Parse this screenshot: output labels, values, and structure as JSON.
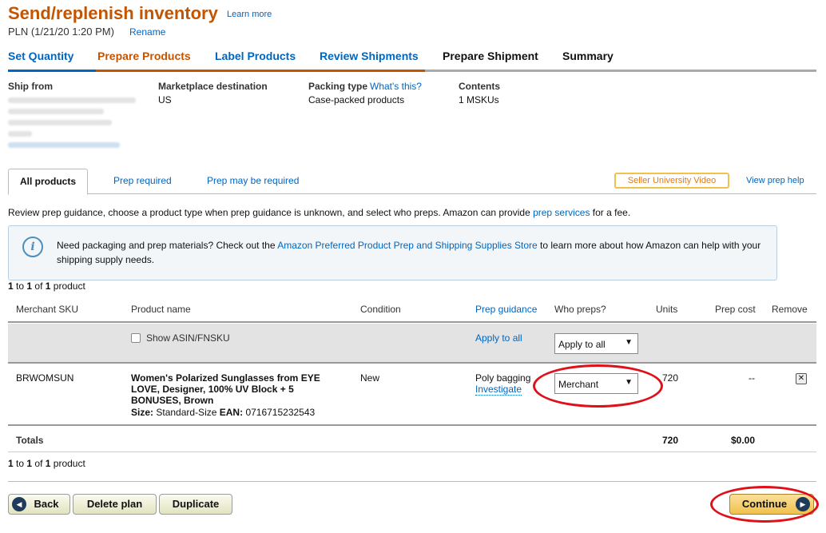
{
  "header": {
    "title": "Send/replenish inventory",
    "learn_more": "Learn more",
    "plan_name": "PLN (1/21/20 1:20 PM)",
    "rename": "Rename"
  },
  "steps": [
    {
      "label": "Set Quantity",
      "state": "done"
    },
    {
      "label": "Prepare Products",
      "state": "active"
    },
    {
      "label": "Label Products",
      "state": "done"
    },
    {
      "label": "Review Shipments",
      "state": "done"
    },
    {
      "label": "Prepare Shipment",
      "state": "future"
    },
    {
      "label": "Summary",
      "state": "future"
    }
  ],
  "info": {
    "ship_from_label": "Ship from",
    "marketplace_label": "Marketplace destination",
    "marketplace_value": "US",
    "packing_label": "Packing type",
    "packing_link": "What's this?",
    "packing_value": "Case-packed products",
    "contents_label": "Contents",
    "contents_value": "1 MSKUs"
  },
  "tabs": {
    "all": "All products",
    "prep_required": "Prep required",
    "prep_may": "Prep may be required",
    "seller_video": "Seller University Video",
    "view_prep_help": "View prep help"
  },
  "guidance": {
    "before": "Review prep guidance, choose a product type when prep guidance is unknown, and select who preps. Amazon can provide ",
    "link": "prep services",
    "after": " for a fee."
  },
  "info_box": {
    "before": "Need packaging and prep materials? Check out the ",
    "link": "Amazon Preferred Product Prep and Shipping Supplies Store",
    "after": " to learn more about how Amazon can help with your shipping supply needs."
  },
  "pagination": {
    "start": "1",
    "to": " to ",
    "end": "1",
    "of": " of ",
    "total": "1",
    "unit": " product"
  },
  "table": {
    "headers": {
      "sku": "Merchant SKU",
      "name": "Product name",
      "condition": "Condition",
      "prep_guidance": "Prep guidance",
      "who_preps": "Who preps?",
      "units": "Units",
      "prep_cost": "Prep cost",
      "remove": "Remove"
    },
    "show_asin": "Show ASIN/FNSKU",
    "apply_to_all_link": "Apply to all",
    "apply_to_all_select": "Apply to all",
    "row": {
      "sku": "BRWOMSUN",
      "name": "Women's Polarized Sunglasses from EYE LOVE, Designer, 100% UV Block + 5 BONUSES, Brown",
      "size_label": "Size:",
      "size_value": "Standard-Size",
      "ean_label": "EAN:",
      "ean_value": "0716715232543",
      "condition": "New",
      "prep_guidance": "Poly bagging",
      "investigate": "Investigate",
      "who_preps": "Merchant",
      "units": "720",
      "prep_cost": "--"
    },
    "totals": {
      "label": "Totals",
      "units": "720",
      "prep_cost": "$0.00"
    }
  },
  "buttons": {
    "back": "Back",
    "delete_plan": "Delete plan",
    "duplicate": "Duplicate",
    "continue": "Continue"
  },
  "colors": {
    "accent_orange": "#c45500",
    "link_blue": "#0066c0",
    "annotation_red": "#e0101a"
  }
}
